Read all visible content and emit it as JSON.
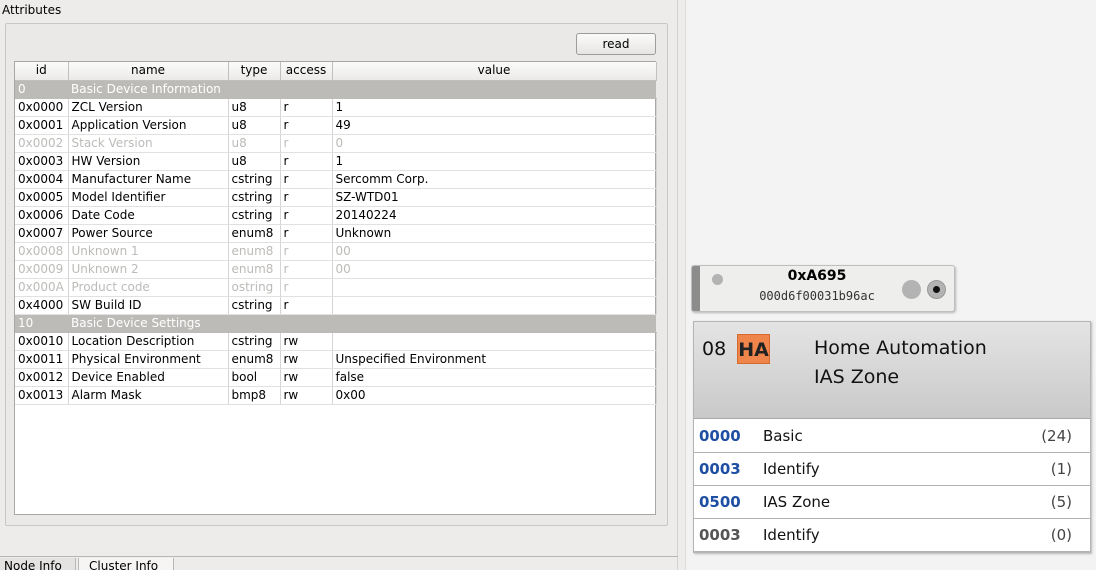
{
  "attributes": {
    "title": "Attributes",
    "read_label": "read",
    "columns": [
      "id",
      "name",
      "type",
      "access",
      "value"
    ],
    "groups": [
      {
        "id": "0",
        "name": "Basic Device Information",
        "rows": [
          {
            "id": "0x0000",
            "name": "ZCL Version",
            "type": "u8",
            "access": "r",
            "value": "1",
            "disabled": false
          },
          {
            "id": "0x0001",
            "name": "Application Version",
            "type": "u8",
            "access": "r",
            "value": "49",
            "disabled": false
          },
          {
            "id": "0x0002",
            "name": "Stack Version",
            "type": "u8",
            "access": "r",
            "value": "0",
            "disabled": true
          },
          {
            "id": "0x0003",
            "name": "HW Version",
            "type": "u8",
            "access": "r",
            "value": "1",
            "disabled": false
          },
          {
            "id": "0x0004",
            "name": "Manufacturer Name",
            "type": "cstring",
            "access": "r",
            "value": "Sercomm Corp.",
            "disabled": false
          },
          {
            "id": "0x0005",
            "name": "Model Identifier",
            "type": "cstring",
            "access": "r",
            "value": "SZ-WTD01",
            "disabled": false
          },
          {
            "id": "0x0006",
            "name": "Date Code",
            "type": "cstring",
            "access": "r",
            "value": "20140224",
            "disabled": false
          },
          {
            "id": "0x0007",
            "name": "Power Source",
            "type": "enum8",
            "access": "r",
            "value": "Unknown",
            "disabled": false
          },
          {
            "id": "0x0008",
            "name": "Unknown 1",
            "type": "enum8",
            "access": "r",
            "value": "00",
            "disabled": true
          },
          {
            "id": "0x0009",
            "name": "Unknown 2",
            "type": "enum8",
            "access": "r",
            "value": "00",
            "disabled": true
          },
          {
            "id": "0x000A",
            "name": "Product code",
            "type": "ostring",
            "access": "r",
            "value": "",
            "disabled": true
          },
          {
            "id": "0x4000",
            "name": "SW Build ID",
            "type": "cstring",
            "access": "r",
            "value": "",
            "disabled": false
          }
        ]
      },
      {
        "id": "10",
        "name": "Basic Device Settings",
        "rows": [
          {
            "id": "0x0010",
            "name": "Location Description",
            "type": "cstring",
            "access": "rw",
            "value": "",
            "disabled": false
          },
          {
            "id": "0x0011",
            "name": "Physical Environment",
            "type": "enum8",
            "access": "rw",
            "value": "Unspecified Environment",
            "disabled": false
          },
          {
            "id": "0x0012",
            "name": "Device Enabled",
            "type": "bool",
            "access": "rw",
            "value": "false",
            "disabled": false
          },
          {
            "id": "0x0013",
            "name": "Alarm Mask",
            "type": "bmp8",
            "access": "rw",
            "value": "0x00",
            "disabled": false
          }
        ]
      }
    ]
  },
  "tabs": [
    {
      "label": "Node Info",
      "active": false
    },
    {
      "label": "Cluster Info",
      "active": true
    }
  ],
  "node": {
    "address": "0xA695",
    "mac": "000d6f00031b96ac",
    "status_color": "#b3b3b3"
  },
  "endpoint": {
    "number": "08",
    "profile_badge": "HA",
    "profile_name": "Home Automation",
    "device_name": "IAS Zone",
    "badge_color": "#f0854c",
    "clusters": [
      {
        "id": "0000",
        "name": "Basic",
        "count": "(24)",
        "direction": "server"
      },
      {
        "id": "0003",
        "name": "Identify",
        "count": "(1)",
        "direction": "server"
      },
      {
        "id": "0500",
        "name": "IAS Zone",
        "count": "(5)",
        "direction": "server"
      },
      {
        "id": "0003",
        "name": "Identify",
        "count": "(0)",
        "direction": "client"
      }
    ]
  }
}
